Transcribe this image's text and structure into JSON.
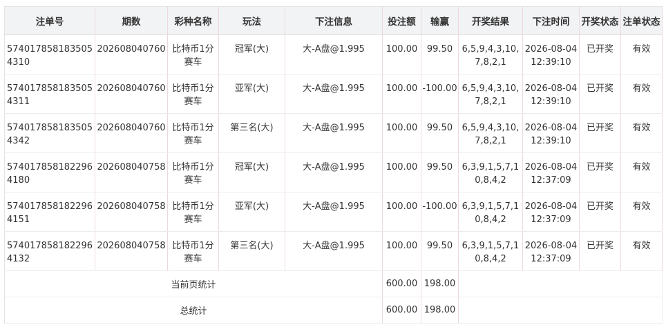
{
  "headers": [
    "注单号",
    "期数",
    "彩种名称",
    "玩法",
    "下注信息",
    "投注额",
    "输赢",
    "开奖结果",
    "下注时间",
    "开奖状态",
    "注单状态"
  ],
  "rows": [
    {
      "order_no": "5740178581835054310",
      "period": "202608040760",
      "lottery": "比特币1分赛车",
      "play": "冠军(大)",
      "bet_info": "大-A盘@1.995",
      "amount": "100.00",
      "win_loss": "99.50",
      "result": "6,5,9,4,3,10,7,8,2,1",
      "bet_time": "2026-08-04 12:39:10",
      "draw_status": "已开奖",
      "order_status": "有效"
    },
    {
      "order_no": "5740178581835054311",
      "period": "202608040760",
      "lottery": "比特币1分赛车",
      "play": "亚军(大)",
      "bet_info": "大-A盘@1.995",
      "amount": "100.00",
      "win_loss": "-100.00",
      "result": "6,5,9,4,3,10,7,8,2,1",
      "bet_time": "2026-08-04 12:39:10",
      "draw_status": "已开奖",
      "order_status": "有效"
    },
    {
      "order_no": "5740178581835054342",
      "period": "202608040760",
      "lottery": "比特币1分赛车",
      "play": "第三名(大)",
      "bet_info": "大-A盘@1.995",
      "amount": "100.00",
      "win_loss": "99.50",
      "result": "6,5,9,4,3,10,7,8,2,1",
      "bet_time": "2026-08-04 12:39:10",
      "draw_status": "已开奖",
      "order_status": "有效"
    },
    {
      "order_no": "5740178581822964180",
      "period": "202608040758",
      "lottery": "比特币1分赛车",
      "play": "冠军(大)",
      "bet_info": "大-A盘@1.995",
      "amount": "100.00",
      "win_loss": "99.50",
      "result": "6,3,9,1,5,7,10,8,4,2",
      "bet_time": "2026-08-04 12:37:09",
      "draw_status": "已开奖",
      "order_status": "有效"
    },
    {
      "order_no": "5740178581822964151",
      "period": "202608040758",
      "lottery": "比特币1分赛车",
      "play": "亚军(大)",
      "bet_info": "大-A盘@1.995",
      "amount": "100.00",
      "win_loss": "-100.00",
      "result": "6,3,9,1,5,7,10,8,4,2",
      "bet_time": "2026-08-04 12:37:09",
      "draw_status": "已开奖",
      "order_status": "有效"
    },
    {
      "order_no": "5740178581822964132",
      "period": "202608040758",
      "lottery": "比特币1分赛车",
      "play": "第三名(大)",
      "bet_info": "大-A盘@1.995",
      "amount": "100.00",
      "win_loss": "99.50",
      "result": "6,3,9,1,5,7,10,8,4,2",
      "bet_time": "2026-08-04 12:37:09",
      "draw_status": "已开奖",
      "order_status": "有效"
    }
  ],
  "page_summary": {
    "label": "当前页统计",
    "amount": "600.00",
    "win_loss": "198.00"
  },
  "total_summary": {
    "label": "总统计",
    "amount": "600.00",
    "win_loss": "198.00"
  }
}
